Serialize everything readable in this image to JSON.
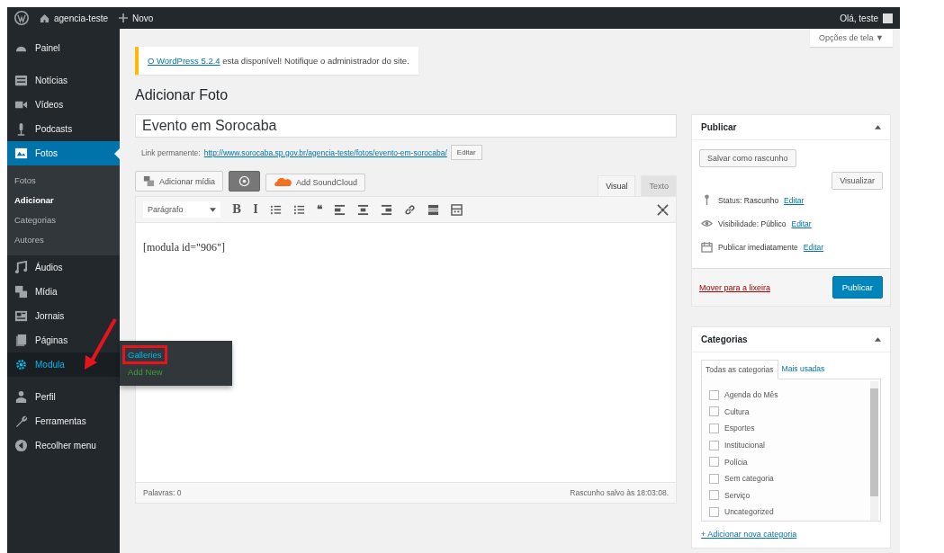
{
  "admin_bar": {
    "site_name": "agencia-teste",
    "new_label": "Novo",
    "greeting": "Olá, teste"
  },
  "sidebar": {
    "sections": [
      {
        "items": [
          {
            "label": "Painel",
            "selected": false,
            "hovered": false
          }
        ]
      },
      {
        "items": [
          {
            "label": "Notícias",
            "selected": false,
            "hovered": false
          },
          {
            "label": "Vídeos",
            "selected": false,
            "hovered": false
          },
          {
            "label": "Podcasts",
            "selected": false,
            "hovered": false
          },
          {
            "label": "Fotos",
            "selected": true,
            "hovered": false,
            "children": [
              {
                "label": "Fotos",
                "selected": false
              },
              {
                "label": "Adicionar",
                "selected": true
              },
              {
                "label": "Categorias",
                "selected": false
              },
              {
                "label": "Autores",
                "selected": false
              }
            ]
          },
          {
            "label": "Áudios",
            "selected": false,
            "hovered": false
          },
          {
            "label": "Mídia",
            "selected": false,
            "hovered": false
          },
          {
            "label": "Jornais",
            "selected": false,
            "hovered": false
          },
          {
            "label": "Páginas",
            "selected": false,
            "hovered": false
          },
          {
            "label": "Modula",
            "selected": false,
            "hovered": true,
            "flyout": [
              {
                "label": "Galleries",
                "kind": "link",
                "highlighted": true
              },
              {
                "label": "Add New",
                "kind": "new",
                "highlighted": false
              }
            ]
          }
        ]
      },
      {
        "items": [
          {
            "label": "Perfil",
            "selected": false,
            "hovered": false
          },
          {
            "label": "Ferramentas",
            "selected": false,
            "hovered": false
          },
          {
            "label": "Recolher menu",
            "selected": false,
            "hovered": false
          }
        ]
      }
    ]
  },
  "screen_options": "Opções de tela ▼",
  "notice": {
    "link": "O WordPress 5.2.4",
    "text": "esta disponível! Notifique o administrador do site."
  },
  "page_title": "Adicionar Foto",
  "post_title": "Evento em Sorocaba",
  "permalink": {
    "label": "Link permanente:",
    "url": "http://www.sorocaba.sp.gov.br/agencia-teste/fotos/evento-em-sorocaba/",
    "button": "Editar"
  },
  "media_buttons": [
    {
      "kind": "media",
      "label": "Adicionar mídia"
    },
    {
      "kind": "dark"
    },
    {
      "kind": "soundcloud",
      "label": "Add SoundCloud"
    }
  ],
  "editor_tabs": [
    {
      "label": "Visual",
      "selected": true
    },
    {
      "label": "Texto",
      "selected": false
    }
  ],
  "format_select": "Parágrafo",
  "toolbar": [
    {
      "kind": "text",
      "glyph": "B"
    },
    {
      "kind": "text",
      "glyph": "I"
    },
    {
      "kind": "bullets"
    },
    {
      "kind": "numbers"
    },
    {
      "kind": "text",
      "glyph": "❝"
    },
    {
      "kind": "align-left"
    },
    {
      "kind": "align-center"
    },
    {
      "kind": "align-right"
    },
    {
      "kind": "link"
    },
    {
      "kind": "more"
    },
    {
      "kind": "kitchen"
    }
  ],
  "content": "[modula id=\"906\"]",
  "status_bar": {
    "words": "Palavras: 0",
    "saved": "Rascunho salvo às 18:03:08."
  },
  "publish": {
    "title": "Publicar",
    "save_draft": "Salvar como rascunho",
    "preview": "Visualizar",
    "rows": [
      {
        "kind": "pin",
        "label": "Status:",
        "value": "Rascunho",
        "link": "Editar"
      },
      {
        "kind": "eye",
        "label": "Visibilidade:",
        "value": "Público",
        "link": "Editar"
      },
      {
        "kind": "calendar",
        "label": "Publicar",
        "value": "imediatamente",
        "link": "Editar"
      }
    ],
    "trash": "Mover para a lixeira",
    "button": "Publicar"
  },
  "categories": {
    "title": "Categorias",
    "tabs": [
      {
        "label": "Todas as categorias",
        "selected": true
      },
      {
        "label": "Mais usadas",
        "selected": false
      }
    ],
    "items": [
      {
        "label": "Agenda do Mês",
        "checked": false
      },
      {
        "label": "Cultura",
        "checked": false
      },
      {
        "label": "Esportes",
        "checked": false
      },
      {
        "label": "Institucional",
        "checked": false
      },
      {
        "label": "Polícia",
        "checked": false
      },
      {
        "label": "Sem categoria",
        "checked": false
      },
      {
        "label": "Serviço",
        "checked": false
      },
      {
        "label": "Uncategorized",
        "checked": false
      }
    ],
    "add_link": "+ Adicionar nova categoria"
  }
}
